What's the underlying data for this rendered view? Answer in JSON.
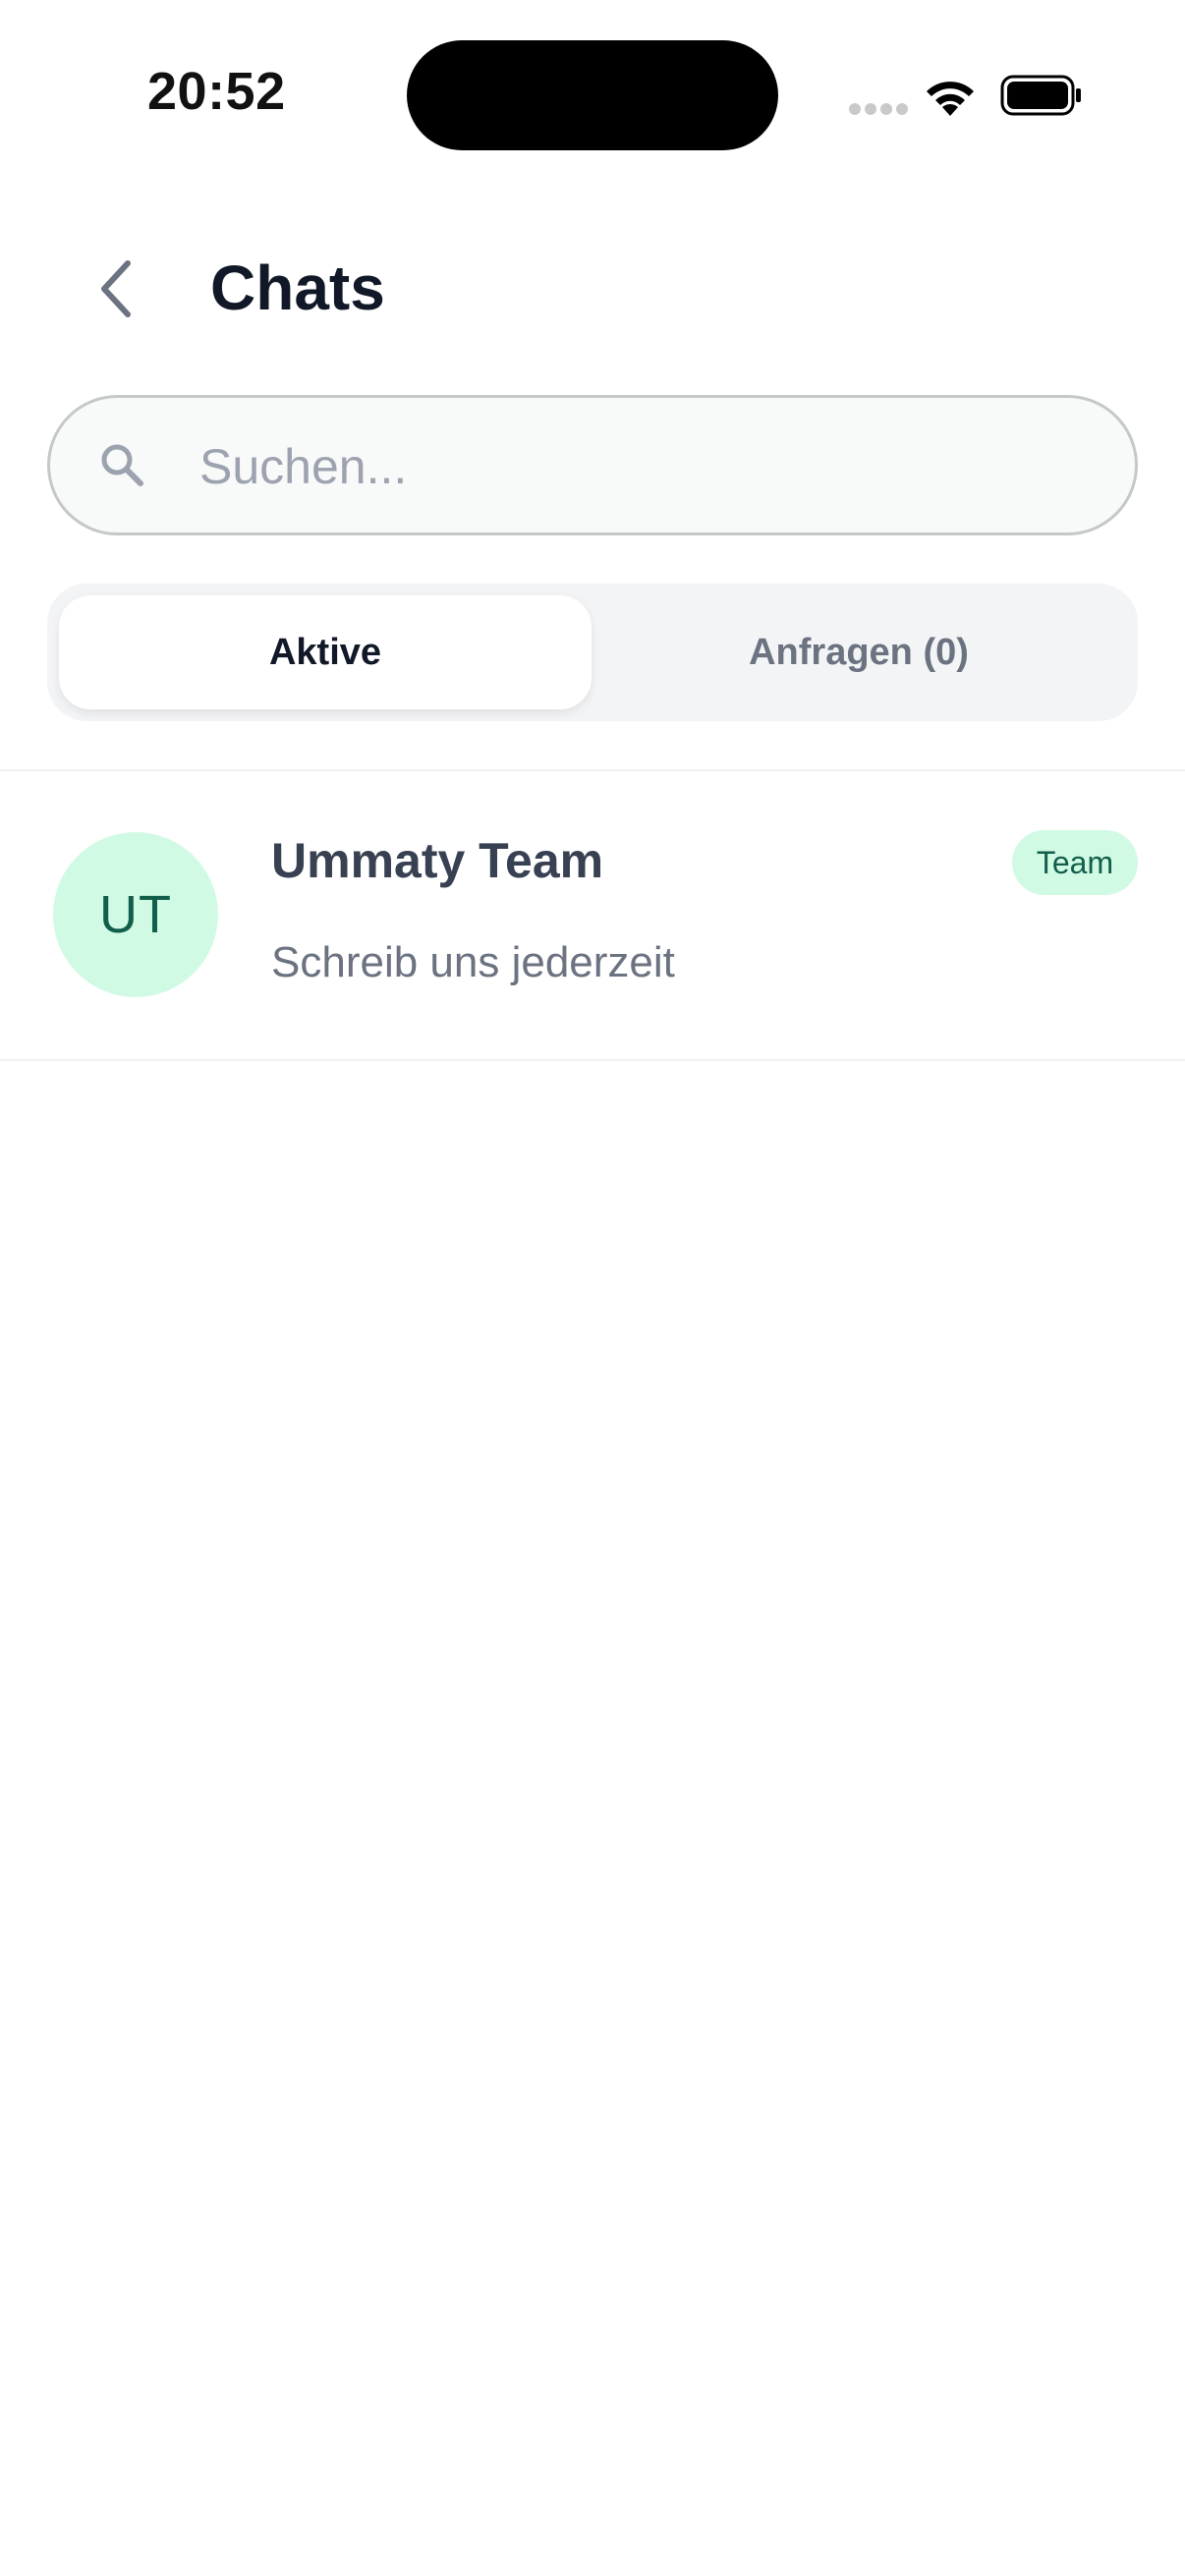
{
  "status_bar": {
    "time": "20:52"
  },
  "header": {
    "title": "Chats",
    "back_icon": "chevron-left-icon"
  },
  "search": {
    "placeholder": "Suchen...",
    "value": "",
    "icon": "search-icon"
  },
  "tabs": [
    {
      "label": "Aktive",
      "selected": true
    },
    {
      "label": "Anfragen (0)",
      "selected": false
    }
  ],
  "chats": [
    {
      "initials": "UT",
      "name": "Ummaty Team",
      "preview": "Schreib uns jederzeit",
      "badge": "Team"
    }
  ],
  "colors": {
    "accent_bg": "#d1fae5",
    "accent_text": "#115e4a",
    "title_text": "#111827",
    "muted_text": "#6b7280"
  }
}
